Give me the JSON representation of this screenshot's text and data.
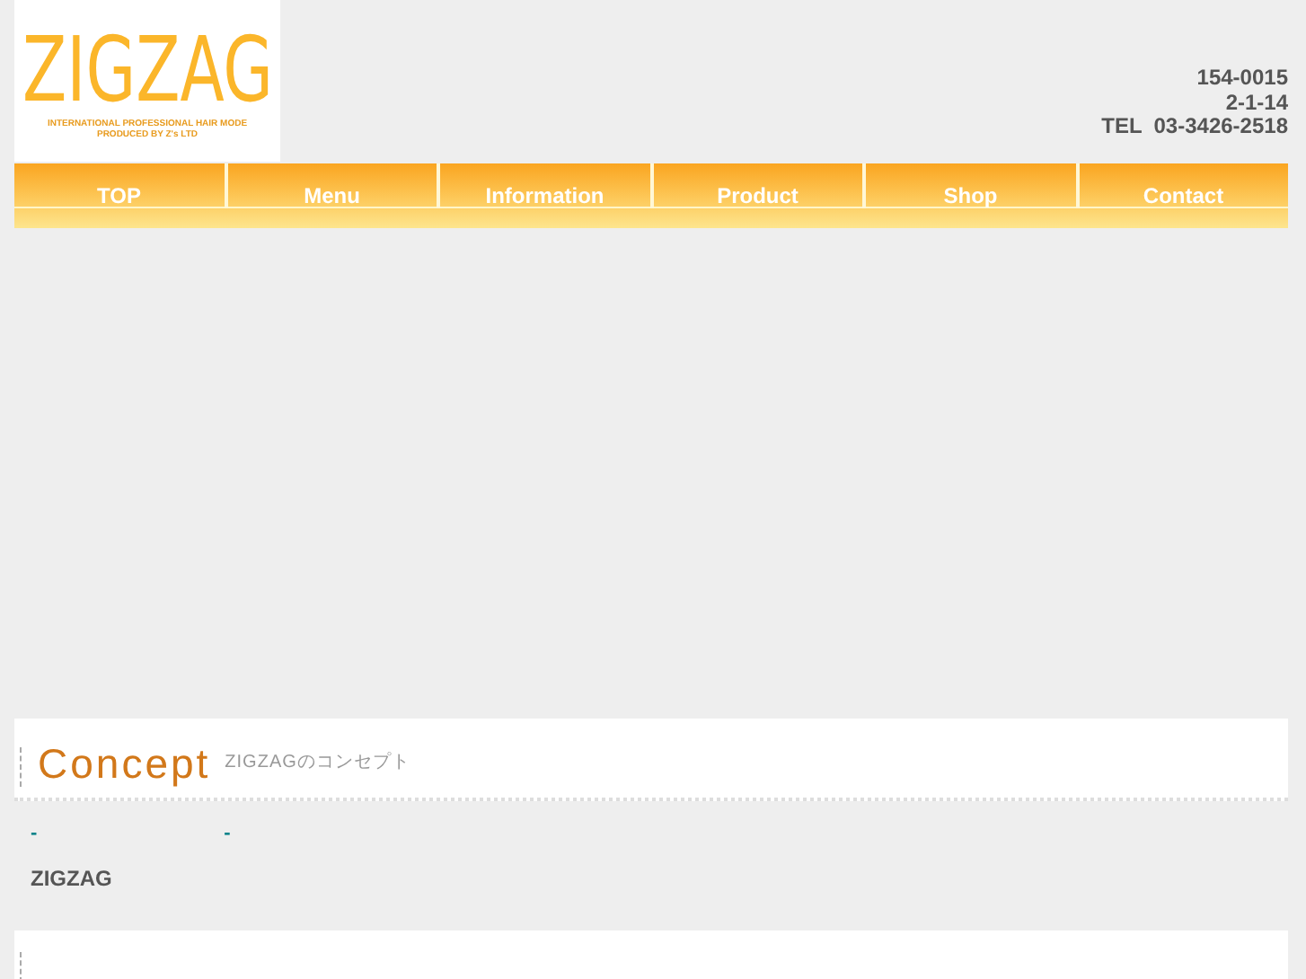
{
  "logo": {
    "wordmark": "ZIGZAG",
    "tagline": "INTERNATIONAL PROFESSIONAL HAIR MODE",
    "producer": "PRODUCED BY Z's LTD"
  },
  "address": {
    "postal_code": "154-0015",
    "street": "2-1-14",
    "phone": "TEL  03-3426-2518"
  },
  "nav": [
    {
      "label": "TOP"
    },
    {
      "label": "Menu"
    },
    {
      "label": "Information"
    },
    {
      "label": "Product"
    },
    {
      "label": "Shop"
    },
    {
      "label": "Contact"
    }
  ],
  "concept": {
    "title": "Concept",
    "subtitle": "ZIGZAGのコンセプト",
    "links": [
      "-",
      "-"
    ],
    "body": "ZIGZAG"
  }
}
